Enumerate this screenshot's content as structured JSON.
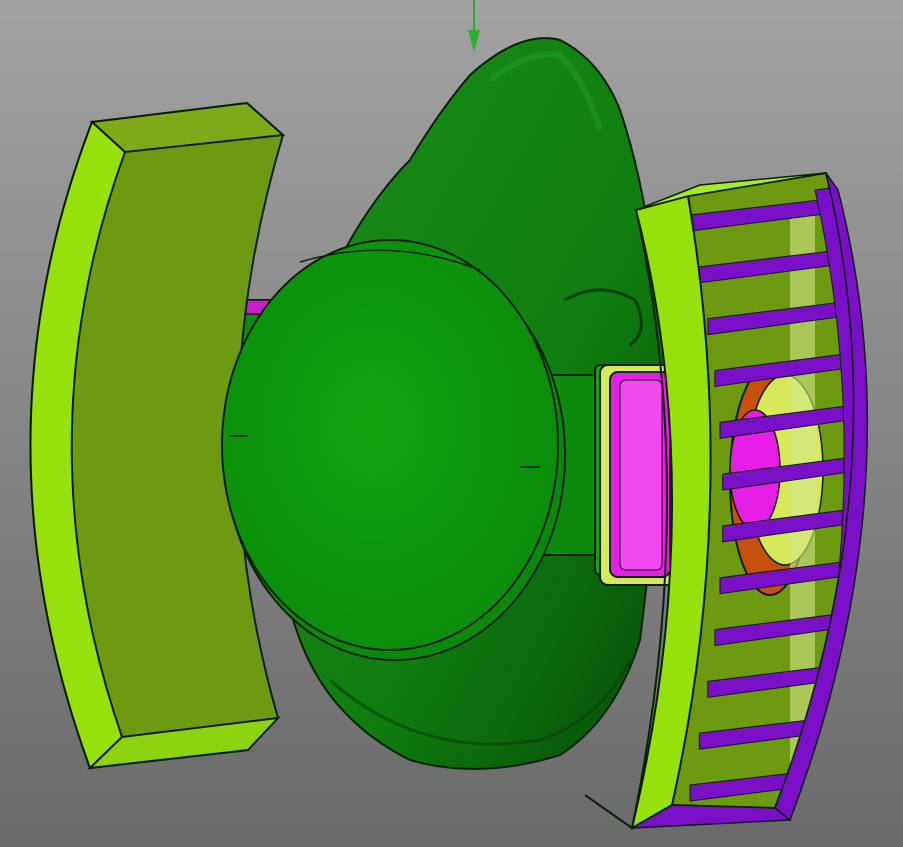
{
  "viewport": {
    "background_top": "#a2a2a2",
    "background_bottom": "#6a6a6a"
  },
  "colors": {
    "mask_green": "#0f7d0f",
    "mask_dark": "#0a5a0a",
    "disc_green": "#0e9a0e",
    "filter_lime": "#96e00c",
    "filter_olive": "#6d9a10",
    "adapter_magenta": "#e61ee6",
    "grid_purple": "#7a0fc8",
    "valve_orange": "#c8500f",
    "axis_green": "#2ab02a",
    "edge": "#0b200b"
  },
  "icons": {
    "axis_indicator": "axis-arrow-icon"
  }
}
